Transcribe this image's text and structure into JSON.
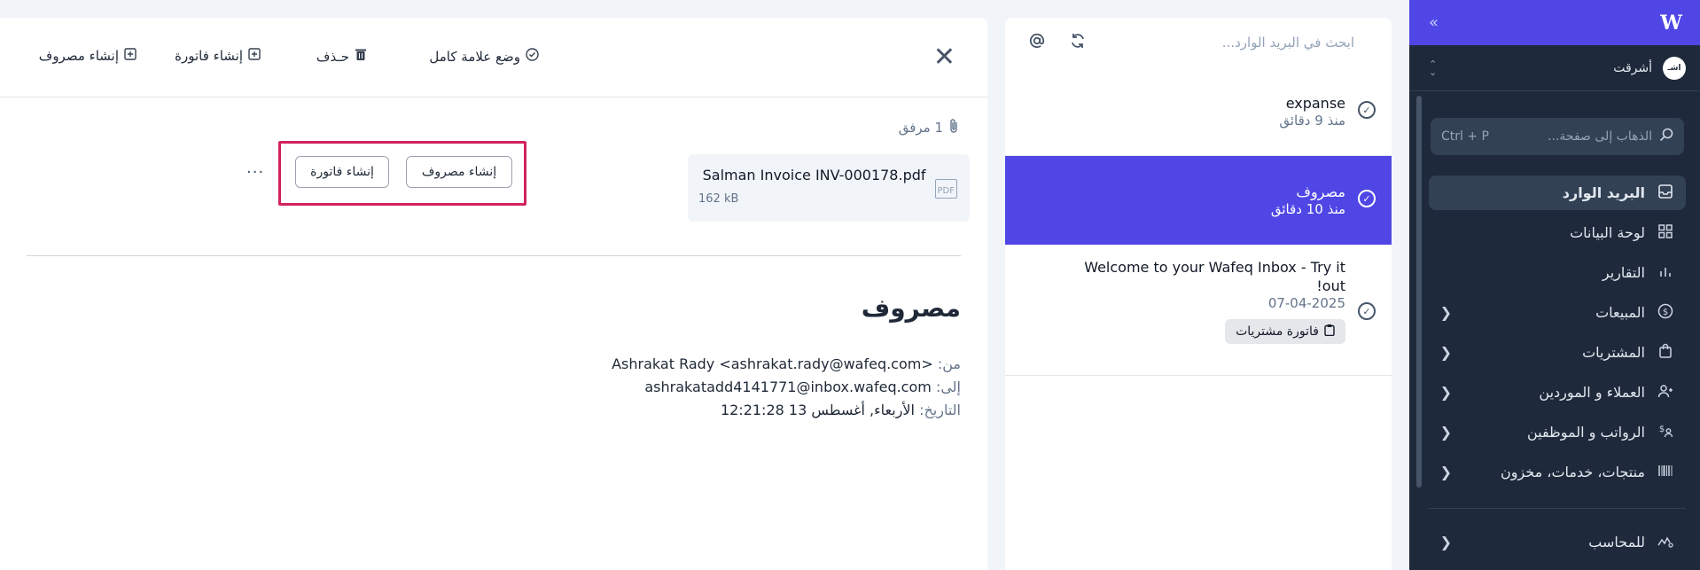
{
  "sidebar": {
    "logo": "W",
    "org_name": "أشرقت",
    "org_avatar": "اشـ",
    "search": {
      "placeholder": "الذهاب إلى صفحة...",
      "shortcut": "Ctrl + P"
    },
    "items": [
      {
        "label": "البريد الوارد",
        "icon": "inbox-icon",
        "active": true,
        "chevron": false
      },
      {
        "label": "لوحة البيانات",
        "icon": "dashboard-icon",
        "active": false,
        "chevron": false
      },
      {
        "label": "التقارير",
        "icon": "chart-icon",
        "active": false,
        "chevron": false
      },
      {
        "label": "المبيعات",
        "icon": "dollar-icon",
        "active": false,
        "chevron": true
      },
      {
        "label": "المشتريات",
        "icon": "bag-icon",
        "active": false,
        "chevron": true
      },
      {
        "label": "العملاء و الموردين",
        "icon": "users-icon",
        "active": false,
        "chevron": true
      },
      {
        "label": "الرواتب و الموظفين",
        "icon": "payroll-icon",
        "active": false,
        "chevron": true
      },
      {
        "label": "منتجات، خدمات، مخزون",
        "icon": "barcode-icon",
        "active": false,
        "chevron": true
      }
    ],
    "accountant": {
      "label": "للمحاسب",
      "icon": "accountant-icon"
    }
  },
  "inbox": {
    "search_placeholder": "ابحث في البريد الوارد...",
    "items": [
      {
        "title": "expanse",
        "time": "منذ 9 دقائق",
        "selected": false
      },
      {
        "title": "مصروف",
        "time": "منذ 10 دقائق",
        "selected": true
      },
      {
        "title": "Welcome to your Wafeq Inbox - Try it out!",
        "time": "07-04-2025",
        "selected": false,
        "tag": "فاتورة مشتريات"
      }
    ]
  },
  "toolbar": {
    "mark_complete": "وضع علامة كامل",
    "delete": "حـذف",
    "create_invoice": "إنشاء فاتورة",
    "create_expense": "إنشاء مصروف"
  },
  "message": {
    "attachments_count": "1 مرفق",
    "file": {
      "name": "Salman Invoice INV-000178.pdf",
      "size": "162 kB",
      "type_label": "PDF"
    },
    "file_actions": {
      "create_expense": "إنشاء مصروف",
      "create_invoice": "إنشاء فاتورة",
      "more": "···"
    },
    "subject": "مصروف",
    "from_label": "من:",
    "from_value": "Ashrakat Rady <ashrakat.rady@wafeq.com>",
    "to_label": "إلى:",
    "to_value": "ashrakatadd4141771@inbox.wafeq.com",
    "date_label": "التاريخ:",
    "date_value": "الأربعاء, أغسطس 13 12:21:28"
  },
  "colors": {
    "accent": "#4f46e5",
    "sidebar_bg": "#1e293b",
    "highlight_border": "#d1225e"
  }
}
